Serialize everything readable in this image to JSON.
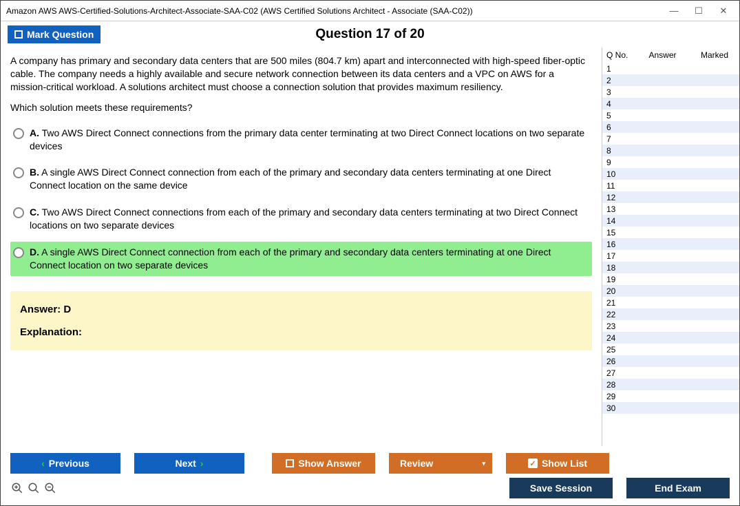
{
  "window_title": "Amazon AWS AWS-Certified-Solutions-Architect-Associate-SAA-C02 (AWS Certified Solutions Architect - Associate (SAA-C02))",
  "mark_label": "Mark Question",
  "question_counter": "Question 17 of 20",
  "question_text": "A company has primary and secondary data centers that are 500 miles (804.7 km) apart and interconnected with high-speed fiber-optic cable. The company needs a highly available and secure network connection between its data centers and a VPC on AWS for a mission-critical workload. A solutions architect must choose a connection solution that provides maximum resiliency.",
  "question_prompt": "Which solution meets these requirements?",
  "options": [
    {
      "letter": "A.",
      "text": "Two AWS Direct Connect connections from the primary data center terminating at two Direct Connect locations on two separate devices",
      "selected": false
    },
    {
      "letter": "B.",
      "text": "A single AWS Direct Connect connection from each of the primary and secondary data centers terminating at one Direct Connect location on the same device",
      "selected": false
    },
    {
      "letter": "C.",
      "text": "Two AWS Direct Connect connections from each of the primary and secondary data centers terminating at two Direct Connect locations on two separate devices",
      "selected": false
    },
    {
      "letter": "D.",
      "text": "A single AWS Direct Connect connection from each of the primary and secondary data centers terminating at one Direct Connect location on two separate devices",
      "selected": true
    }
  ],
  "answer_label": "Answer: D",
  "explanation_label": "Explanation:",
  "side_headers": {
    "qno": "Q No.",
    "answer": "Answer",
    "marked": "Marked"
  },
  "question_list": [
    1,
    2,
    3,
    4,
    5,
    6,
    7,
    8,
    9,
    10,
    11,
    12,
    13,
    14,
    15,
    16,
    17,
    18,
    19,
    20,
    21,
    22,
    23,
    24,
    25,
    26,
    27,
    28,
    29,
    30
  ],
  "buttons": {
    "previous": "Previous",
    "next": "Next",
    "show_answer": "Show Answer",
    "review": "Review",
    "show_list": "Show List",
    "save_session": "Save Session",
    "end_exam": "End Exam"
  }
}
